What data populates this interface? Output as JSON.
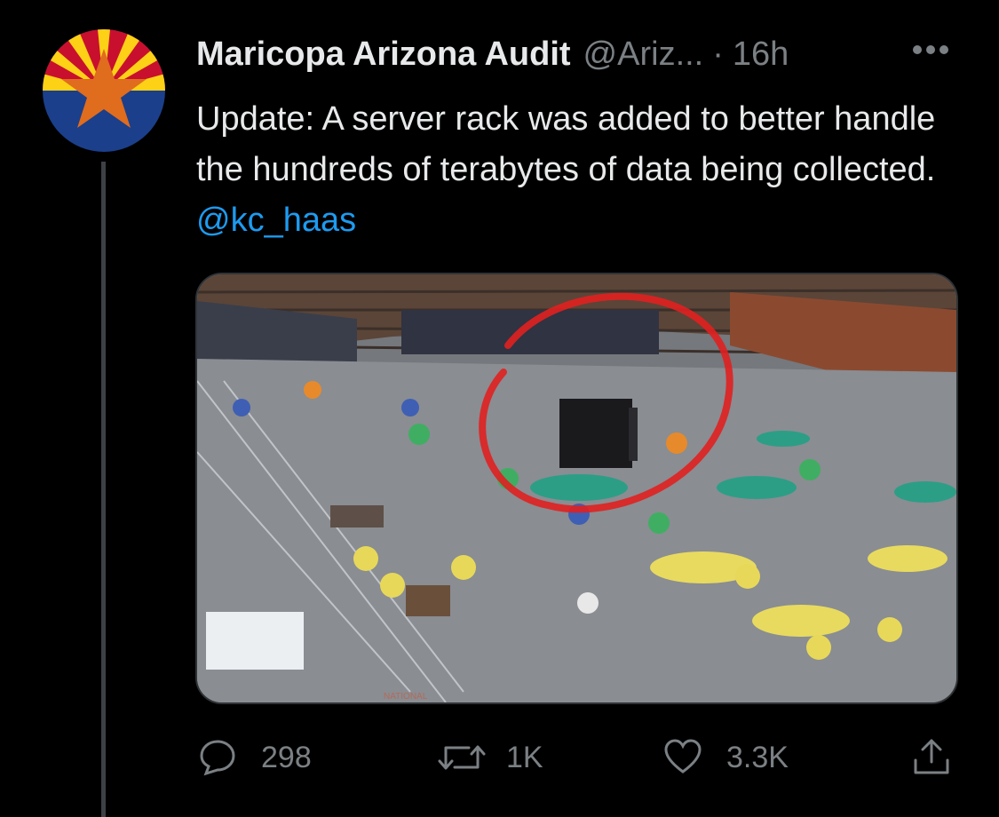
{
  "tweet": {
    "author_name": "Maricopa Arizona Audit",
    "author_handle": "@Ariz...",
    "separator": "·",
    "time": "16h",
    "text_main": "Update: A server rack was added to better handle the hundreds of terabytes of data being collected.",
    "mention": "@kc_haas"
  },
  "media": {
    "banner_text": "NATIONAL"
  },
  "actions": {
    "reply_count": "298",
    "retweet_count": "1K",
    "like_count": "3.3K"
  },
  "colors": {
    "background": "#000000",
    "text": "#e7e9ea",
    "muted": "#7b8084",
    "link": "#1d9bf0",
    "flag_red": "#c8102e",
    "flag_blue": "#1b3f8a",
    "flag_yellow": "#fcd116",
    "star_copper": "#e06c1d",
    "annotation_red": "#e02020"
  }
}
